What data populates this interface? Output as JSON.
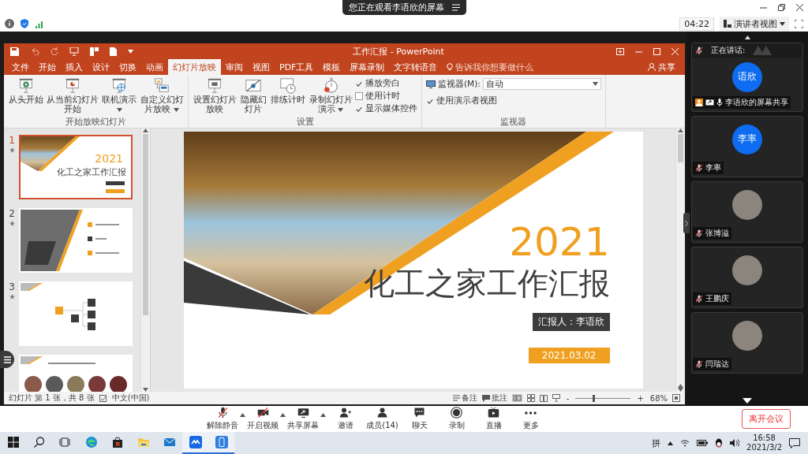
{
  "meeting_header": {
    "banner": "您正在观看李语欣的屏幕",
    "timer": "04:22",
    "view_menu": "演讲者视图"
  },
  "ppt": {
    "title": "工作汇报 - PowerPoint",
    "tabs": [
      {
        "label": "文件",
        "selected": false
      },
      {
        "label": "开始",
        "selected": false
      },
      {
        "label": "插入",
        "selected": false
      },
      {
        "label": "设计",
        "selected": false
      },
      {
        "label": "切换",
        "selected": false
      },
      {
        "label": "动画",
        "selected": false
      },
      {
        "label": "幻灯片放映",
        "selected": true
      },
      {
        "label": "审阅",
        "selected": false
      },
      {
        "label": "视图",
        "selected": false
      },
      {
        "label": "PDF工具",
        "selected": false
      },
      {
        "label": "模板",
        "selected": false
      },
      {
        "label": "屏幕录制",
        "selected": false
      },
      {
        "label": "文字转语音",
        "selected": false
      }
    ],
    "tell_me": "告诉我你想要做什么",
    "share": "共享",
    "ribbon": [
      {
        "title": "开始放映幻灯片",
        "buttons": [
          {
            "label": "从头开始",
            "dropdown": false
          },
          {
            "label": "从当前幻灯片开始",
            "dropdown": false
          },
          {
            "label": "联机演示",
            "dropdown": true
          },
          {
            "label": "自定义幻灯片放映",
            "dropdown": true
          }
        ]
      },
      {
        "title": "设置",
        "buttons": [
          {
            "label": "设置幻灯片放映",
            "dropdown": false
          },
          {
            "label": "隐藏幻灯片",
            "dropdown": false
          },
          {
            "label": "排练计时",
            "dropdown": false
          },
          {
            "label": "录制幻灯片演示",
            "dropdown": true
          }
        ],
        "checks": [
          {
            "label": "播放旁白",
            "checked": true
          },
          {
            "label": "使用计时",
            "checked": false
          },
          {
            "label": "显示媒体控件",
            "checked": true
          }
        ]
      },
      {
        "title": "监视器",
        "fields": [
          {
            "label": "监视器(M):",
            "value": "自动"
          }
        ],
        "checks": [
          {
            "label": "使用演示者视图",
            "checked": true
          }
        ]
      }
    ],
    "thumbnails": [
      {
        "number": "1",
        "selected": true,
        "kind": "title",
        "year": "2021",
        "title": "化工之家工作汇报"
      },
      {
        "number": "2",
        "selected": false,
        "kind": "contents"
      },
      {
        "number": "3",
        "selected": false,
        "kind": "diagram"
      },
      {
        "selected": false,
        "kind": "photos"
      }
    ],
    "slide": {
      "year": "2021",
      "title": "化工之家工作汇报",
      "presenter": "汇报人：李语欣",
      "date": "2021.03.02"
    },
    "status": {
      "slide_count": "幻灯片 第 1 张，共 8 张",
      "language": "中文(中国)",
      "notes": "备注",
      "comments": "批注",
      "zoom_out": "-",
      "zoom_in": "+",
      "zoom_slider": {
        "level": 0.32
      },
      "zoom": "68%"
    }
  },
  "panel": {
    "speaking_label": "正在讲话:",
    "tiles": [
      {
        "kind": "share",
        "initials": "语欣",
        "name": "李语欣的屏幕共享"
      },
      {
        "kind": "initials",
        "initials": "李率",
        "name": "李率"
      },
      {
        "kind": "photo",
        "name": "张博溢"
      },
      {
        "kind": "photo",
        "name": "王鹏庆"
      },
      {
        "kind": "photo",
        "name": "闫瑞达"
      }
    ]
  },
  "toolbar": {
    "buttons": [
      {
        "label": "解除静音",
        "kind": "mic-off",
        "menu": true
      },
      {
        "label": "开启视频",
        "kind": "camera-off",
        "menu": true
      },
      {
        "label": "共享屏幕",
        "kind": "share",
        "menu": true
      },
      {
        "label": "邀请",
        "kind": "invite",
        "menu": false
      },
      {
        "label": "成员(14)",
        "kind": "members",
        "menu": false
      },
      {
        "label": "聊天",
        "kind": "chat",
        "menu": false
      },
      {
        "label": "录制",
        "kind": "record",
        "menu": false
      },
      {
        "label": "直播",
        "kind": "live",
        "menu": false
      },
      {
        "label": "更多",
        "kind": "more",
        "menu": false
      }
    ],
    "leave": "离开会议"
  },
  "taskbar": {
    "apps": [
      {
        "kind": "start",
        "selected": false
      },
      {
        "kind": "search",
        "selected": false
      },
      {
        "kind": "taskview",
        "selected": false
      },
      {
        "kind": "browser",
        "selected": false
      },
      {
        "kind": "store",
        "selected": false
      },
      {
        "kind": "folder",
        "selected": false
      },
      {
        "kind": "mail",
        "selected": false
      },
      {
        "kind": "meeting",
        "selected": true
      },
      {
        "kind": "phone",
        "selected": true
      }
    ],
    "ime": "拼",
    "time": "16:58",
    "date": "2021/3/2"
  }
}
